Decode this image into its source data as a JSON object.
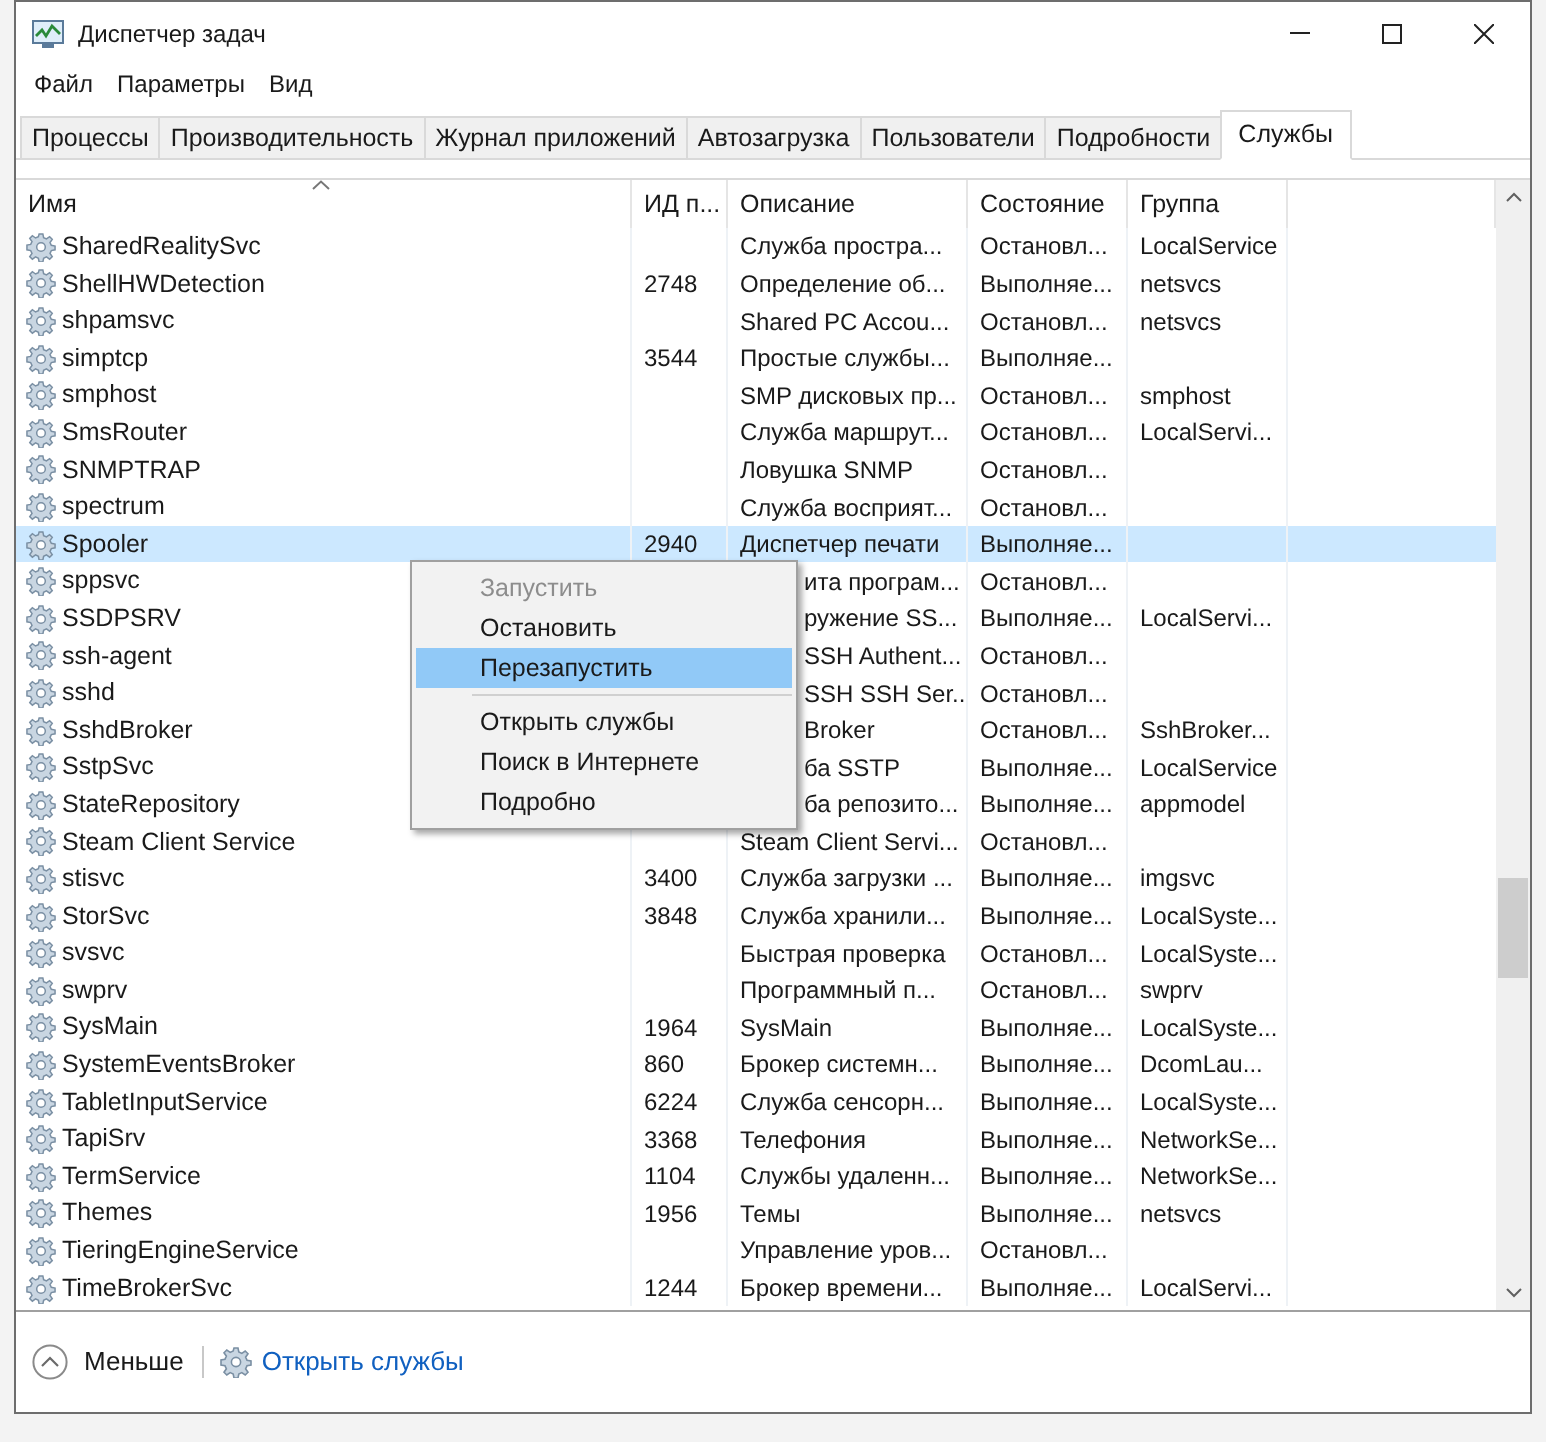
{
  "window": {
    "title": "Диспетчер задач"
  },
  "menu_bar": [
    "Файл",
    "Параметры",
    "Вид"
  ],
  "tabs": [
    {
      "label": "Процессы",
      "selected": false
    },
    {
      "label": "Производительность",
      "selected": false
    },
    {
      "label": "Журнал приложений",
      "selected": false
    },
    {
      "label": "Автозагрузка",
      "selected": false
    },
    {
      "label": "Пользователи",
      "selected": false
    },
    {
      "label": "Подробности",
      "selected": false
    },
    {
      "label": "Службы",
      "selected": true
    }
  ],
  "table": {
    "columns": [
      "Имя",
      "ИД п...",
      "Описание",
      "Состояние",
      "Группа"
    ],
    "rows": [
      {
        "name": "SharedRealitySvc",
        "pid": "",
        "description": "Служба простра...",
        "status": "Остановл...",
        "group": "LocalService",
        "selected": false
      },
      {
        "name": "ShellHWDetection",
        "pid": "2748",
        "description": "Определение об...",
        "status": "Выполняе...",
        "group": "netsvcs",
        "selected": false
      },
      {
        "name": "shpamsvc",
        "pid": "",
        "description": "Shared PC Accou...",
        "status": "Остановл...",
        "group": "netsvcs",
        "selected": false
      },
      {
        "name": "simptcp",
        "pid": "3544",
        "description": "Простые службы...",
        "status": "Выполняе...",
        "group": "",
        "selected": false
      },
      {
        "name": "smphost",
        "pid": "",
        "description": "SMP дисковых пр...",
        "status": "Остановл...",
        "group": "smphost",
        "selected": false
      },
      {
        "name": "SmsRouter",
        "pid": "",
        "description": "Служба маршрут...",
        "status": "Остановл...",
        "group": "LocalServi...",
        "selected": false
      },
      {
        "name": "SNMPTRAP",
        "pid": "",
        "description": "Ловушка SNMP",
        "status": "Остановл...",
        "group": "",
        "selected": false
      },
      {
        "name": "spectrum",
        "pid": "",
        "description": "Служба восприят...",
        "status": "Остановл...",
        "group": "",
        "selected": false
      },
      {
        "name": "Spooler",
        "pid": "2940",
        "description": "Диспетчер печати",
        "status": "Выполняе...",
        "group": "",
        "selected": true
      },
      {
        "name": "sppsvc",
        "pid": "",
        "description": "ита програм...",
        "status": "Остановл...",
        "group": "",
        "selected": false,
        "covered": true
      },
      {
        "name": "SSDPSRV",
        "pid": "",
        "description": "ружение SS...",
        "status": "Выполняе...",
        "group": "LocalServi...",
        "selected": false,
        "covered": true
      },
      {
        "name": "ssh-agent",
        "pid": "",
        "description": "SSH Authent...",
        "status": "Остановл...",
        "group": "",
        "selected": false,
        "covered": true
      },
      {
        "name": "sshd",
        "pid": "",
        "description": "SSH SSH Ser...",
        "status": "Остановл...",
        "group": "",
        "selected": false,
        "covered": true
      },
      {
        "name": "SshdBroker",
        "pid": "",
        "description": "Broker",
        "status": "Остановл...",
        "group": "SshBroker...",
        "selected": false,
        "covered": true
      },
      {
        "name": "SstpSvc",
        "pid": "",
        "description": "ба SSTP",
        "status": "Выполняе...",
        "group": "LocalService",
        "selected": false,
        "covered": true
      },
      {
        "name": "StateRepository",
        "pid": "",
        "description": "ба репозито...",
        "status": "Выполняе...",
        "group": "appmodel",
        "selected": false,
        "covered": true
      },
      {
        "name": "Steam Client Service",
        "pid": "",
        "description": "Steam Client Servi...",
        "status": "Остановл...",
        "group": "",
        "selected": false
      },
      {
        "name": "stisvc",
        "pid": "3400",
        "description": "Служба загрузки ...",
        "status": "Выполняе...",
        "group": "imgsvc",
        "selected": false
      },
      {
        "name": "StorSvc",
        "pid": "3848",
        "description": "Служба хранили...",
        "status": "Выполняе...",
        "group": "LocalSyste...",
        "selected": false
      },
      {
        "name": "svsvc",
        "pid": "",
        "description": "Быстрая проверка",
        "status": "Остановл...",
        "group": "LocalSyste...",
        "selected": false
      },
      {
        "name": "swprv",
        "pid": "",
        "description": "Программный п...",
        "status": "Остановл...",
        "group": "swprv",
        "selected": false
      },
      {
        "name": "SysMain",
        "pid": "1964",
        "description": "SysMain",
        "status": "Выполняе...",
        "group": "LocalSyste...",
        "selected": false
      },
      {
        "name": "SystemEventsBroker",
        "pid": "860",
        "description": "Брокер системн...",
        "status": "Выполняе...",
        "group": "DcomLau...",
        "selected": false
      },
      {
        "name": "TabletInputService",
        "pid": "6224",
        "description": "Служба сенсорн...",
        "status": "Выполняе...",
        "group": "LocalSyste...",
        "selected": false
      },
      {
        "name": "TapiSrv",
        "pid": "3368",
        "description": "Телефония",
        "status": "Выполняе...",
        "group": "NetworkSe...",
        "selected": false
      },
      {
        "name": "TermService",
        "pid": "1104",
        "description": "Службы удаленн...",
        "status": "Выполняе...",
        "group": "NetworkSe...",
        "selected": false
      },
      {
        "name": "Themes",
        "pid": "1956",
        "description": "Темы",
        "status": "Выполняе...",
        "group": "netsvcs",
        "selected": false
      },
      {
        "name": "TieringEngineService",
        "pid": "",
        "description": "Управление уров...",
        "status": "Остановл...",
        "group": "",
        "selected": false
      },
      {
        "name": "TimeBrokerSvc",
        "pid": "1244",
        "description": "Брокер времени...",
        "status": "Выполняе...",
        "group": "LocalServi...",
        "selected": false
      }
    ]
  },
  "context_menu": [
    {
      "kind": "item",
      "label": "Запустить",
      "disabled": true,
      "selected": false
    },
    {
      "kind": "item",
      "label": "Остановить",
      "disabled": false,
      "selected": false
    },
    {
      "kind": "item",
      "label": "Перезапустить",
      "disabled": false,
      "selected": true
    },
    {
      "kind": "separator"
    },
    {
      "kind": "item",
      "label": "Открыть службы",
      "disabled": false,
      "selected": false
    },
    {
      "kind": "item",
      "label": "Поиск в Интернете",
      "disabled": false,
      "selected": false
    },
    {
      "kind": "item",
      "label": "Подробно",
      "disabled": false,
      "selected": false
    }
  ],
  "footer": {
    "fewer_details": "Меньше",
    "open_services": "Открыть службы"
  }
}
